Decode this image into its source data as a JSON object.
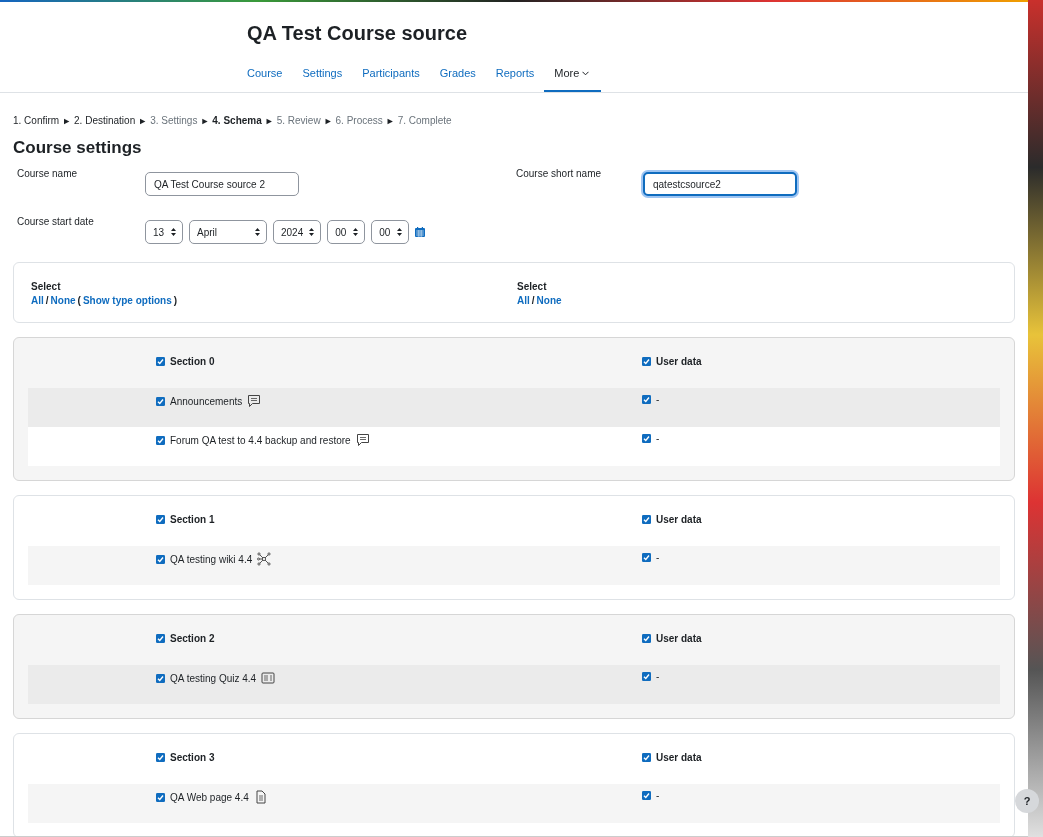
{
  "header": {
    "title": "QA Test Course source"
  },
  "nav": [
    {
      "label": "Course",
      "selected": false,
      "kind": "link"
    },
    {
      "label": "Settings",
      "selected": false,
      "kind": "link"
    },
    {
      "label": "Participants",
      "selected": false,
      "kind": "link"
    },
    {
      "label": "Grades",
      "selected": false,
      "kind": "link"
    },
    {
      "label": "Reports",
      "selected": false,
      "kind": "link"
    },
    {
      "label": "More",
      "selected": true,
      "kind": "menu"
    }
  ],
  "steps": {
    "separator": "►",
    "items": [
      {
        "label": "1. Confirm",
        "kind": "done"
      },
      {
        "label": "2. Destination",
        "kind": "done"
      },
      {
        "label": "3. Settings",
        "kind": "skipped"
      },
      {
        "label": "4. Schema",
        "kind": "current"
      },
      {
        "label": "5. Review",
        "kind": "upcoming"
      },
      {
        "label": "6. Process",
        "kind": "upcoming"
      },
      {
        "label": "7. Complete",
        "kind": "upcoming"
      }
    ]
  },
  "settings": {
    "heading": "Course settings",
    "course_name": {
      "label": "Course name",
      "value": "QA Test Course source 2",
      "focused": false
    },
    "short_name": {
      "label": "Course short name",
      "value": "qatestcsource2",
      "focused": true
    },
    "start_date": {
      "label": "Course start date",
      "selects": [
        {
          "value": "13",
          "kind": "short"
        },
        {
          "value": "April",
          "kind": "wide"
        },
        {
          "value": "2024",
          "kind": "short"
        },
        {
          "value": "00",
          "kind": "short"
        },
        {
          "value": "00",
          "kind": "short"
        }
      ]
    }
  },
  "select_panels": [
    {
      "label": "Select",
      "parts": [
        {
          "text": "All",
          "kind": "link"
        },
        {
          "text": "/",
          "kind": "text"
        },
        {
          "text": "None",
          "kind": "link"
        },
        {
          "text": "(",
          "kind": "text"
        },
        {
          "text": "Show type options",
          "kind": "link"
        },
        {
          "text": ")",
          "kind": "text"
        }
      ]
    },
    {
      "label": "Select",
      "parts": [
        {
          "text": "All",
          "kind": "link"
        },
        {
          "text": "/",
          "kind": "text"
        },
        {
          "text": "None",
          "kind": "link"
        }
      ]
    }
  ],
  "sections": [
    {
      "title": "Section 0",
      "checked": true,
      "userdata_label": "User data",
      "userdata_checked": true,
      "activities": [
        {
          "name": "Announcements",
          "kind": "forum",
          "checked": true,
          "userdata": "-",
          "userdata_checked": true
        },
        {
          "name": "Forum QA test to 4.4 backup and restore",
          "kind": "forum",
          "checked": true,
          "userdata": "-",
          "userdata_checked": true
        }
      ]
    },
    {
      "title": "Section 1",
      "checked": true,
      "userdata_label": "User data",
      "userdata_checked": true,
      "activities": [
        {
          "name": "QA testing wiki 4.4",
          "kind": "wiki",
          "checked": true,
          "userdata": "-",
          "userdata_checked": true
        }
      ]
    },
    {
      "title": "Section 2",
      "checked": true,
      "userdata_label": "User data",
      "userdata_checked": true,
      "activities": [
        {
          "name": "QA testing Quiz 4.4",
          "kind": "quiz",
          "checked": true,
          "userdata": "-",
          "userdata_checked": true
        }
      ]
    },
    {
      "title": "Section 3",
      "checked": true,
      "userdata_label": "User data",
      "userdata_checked": true,
      "activities": [
        {
          "name": "QA Web page 4.4",
          "kind": "page",
          "checked": true,
          "userdata": "-",
          "userdata_checked": true
        }
      ]
    }
  ],
  "help_button": {
    "label": "?"
  }
}
